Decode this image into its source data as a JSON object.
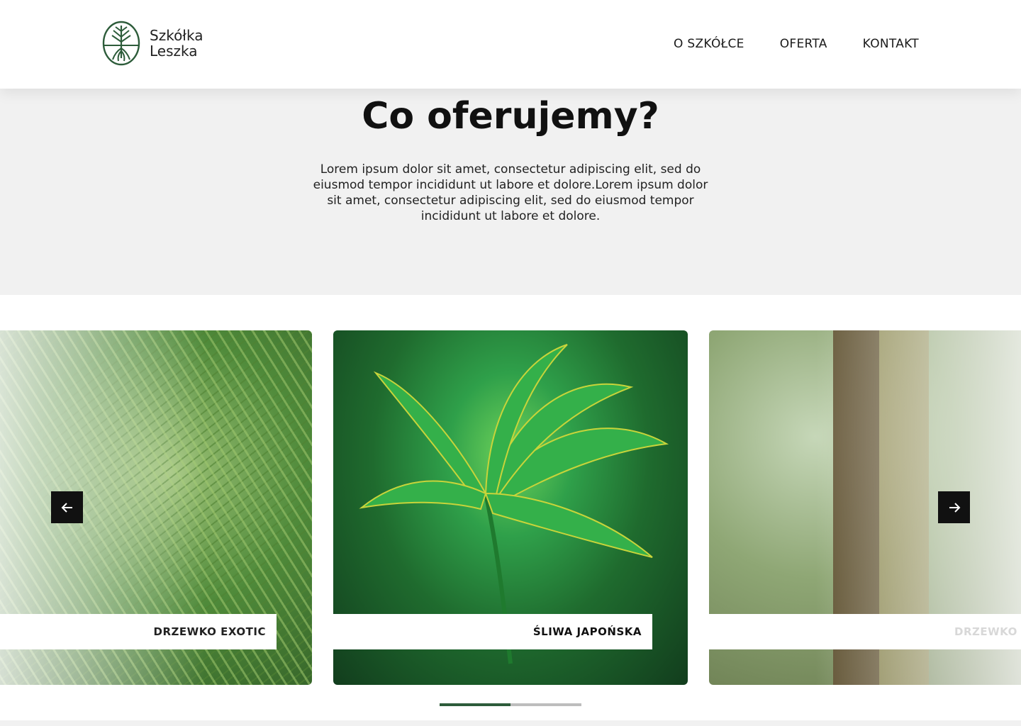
{
  "brand": {
    "line1": "Szkółka",
    "line2": "Leszka",
    "logo_icon": "tree-roots-logo-icon",
    "color": "#2d5c3a"
  },
  "nav": {
    "items": [
      "O SZKÓŁCE",
      "OFERTA",
      "KONTAKT"
    ]
  },
  "hero": {
    "title": "Co oferujemy?",
    "intro": "Lorem ipsum dolor sit amet, consectetur adipiscing elit, sed do eiusmod tempor incididunt ut labore et dolore.Lorem ipsum dolor sit amet, consectetur adipiscing elit, sed do eiusmod tempor incididunt ut labore et dolore."
  },
  "slider": {
    "cards": [
      {
        "label": "DRZEWKO EXOTIC",
        "state": "previous"
      },
      {
        "label": "ŚLIWA JAPOŃSKA",
        "state": "active"
      },
      {
        "label": "DRZEWKO",
        "state": "next"
      }
    ],
    "prev_icon": "arrow-left-icon",
    "next_icon": "arrow-right-icon",
    "progress": 0.5,
    "accent": "#2d5c3a"
  }
}
